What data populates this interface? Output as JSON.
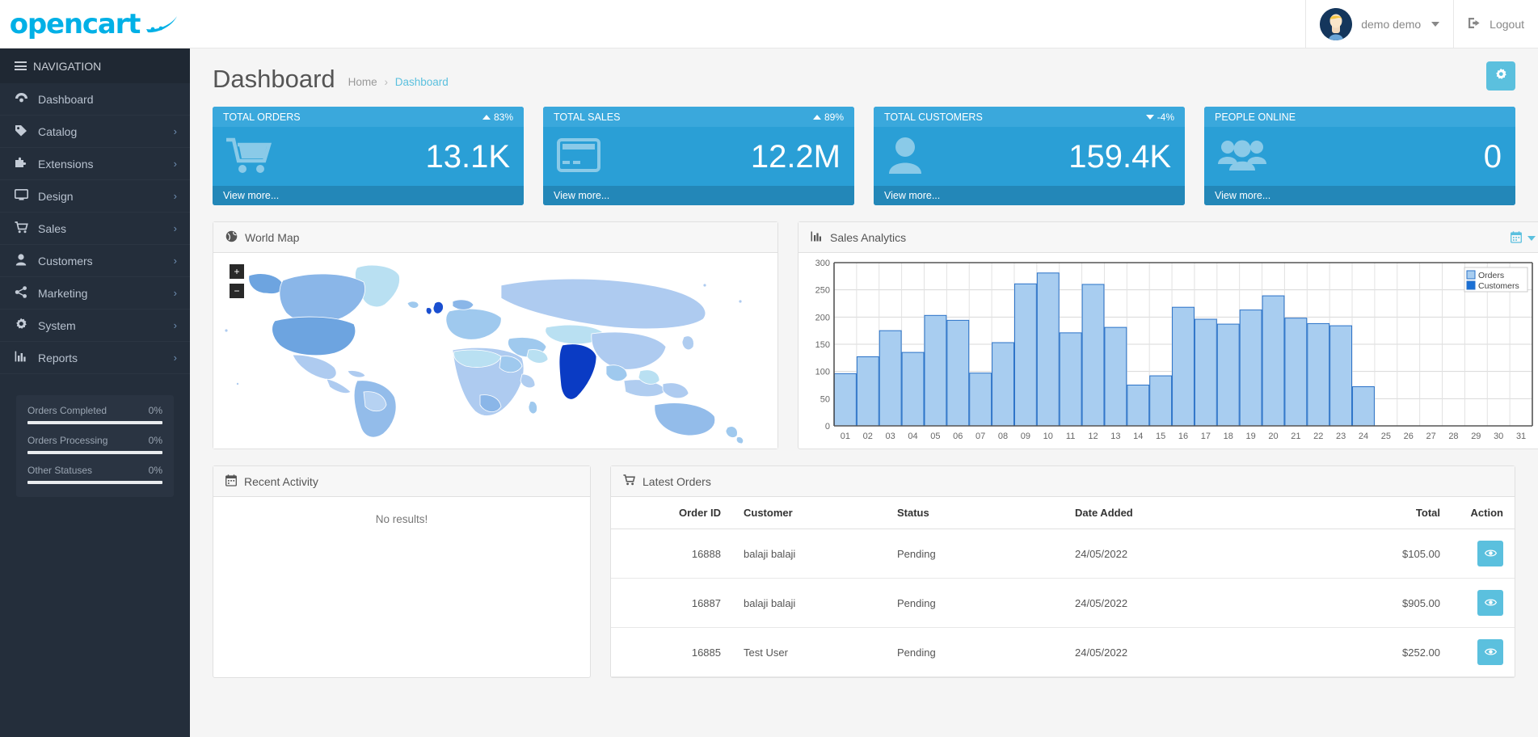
{
  "brand": {
    "logo_text": "opencart",
    "accent": "#00b0e6"
  },
  "header": {
    "user_name": "demo demo",
    "logout_label": "Logout",
    "user_caret_icon": "chevron-down-icon",
    "logout_icon": "sign-out-icon",
    "avatar_icon": "user-avatar"
  },
  "sidebar": {
    "nav_title": "NAVIGATION",
    "items": [
      {
        "label": "Dashboard",
        "icon": "dashboard-icon",
        "has_children": false
      },
      {
        "label": "Catalog",
        "icon": "tag-icon",
        "has_children": true
      },
      {
        "label": "Extensions",
        "icon": "puzzle-icon",
        "has_children": true
      },
      {
        "label": "Design",
        "icon": "desktop-icon",
        "has_children": true
      },
      {
        "label": "Sales",
        "icon": "cart-icon",
        "has_children": true
      },
      {
        "label": "Customers",
        "icon": "user-icon",
        "has_children": true
      },
      {
        "label": "Marketing",
        "icon": "share-icon",
        "has_children": true
      },
      {
        "label": "System",
        "icon": "gear-icon",
        "has_children": true
      },
      {
        "label": "Reports",
        "icon": "bar-chart-icon",
        "has_children": true
      }
    ],
    "progress": [
      {
        "label": "Orders Completed",
        "value": "0%",
        "percent": 0
      },
      {
        "label": "Orders Processing",
        "value": "0%",
        "percent": 0
      },
      {
        "label": "Other Statuses",
        "value": "0%",
        "percent": 0
      }
    ]
  },
  "page": {
    "title": "Dashboard",
    "breadcrumb_home": "Home",
    "breadcrumb_sep": "›",
    "breadcrumb_current": "Dashboard",
    "settings_icon": "gear-icon"
  },
  "tiles": [
    {
      "title": "TOTAL ORDERS",
      "percent": "83%",
      "direction": "up",
      "value": "13.1K",
      "footer": "View more...",
      "icon": "shopping-cart-icon"
    },
    {
      "title": "TOTAL SALES",
      "percent": "89%",
      "direction": "up",
      "value": "12.2M",
      "footer": "View more...",
      "icon": "credit-card-icon"
    },
    {
      "title": "TOTAL CUSTOMERS",
      "percent": "-4%",
      "direction": "down",
      "value": "159.4K",
      "footer": "View more...",
      "icon": "user-icon"
    },
    {
      "title": "PEOPLE ONLINE",
      "percent": "",
      "direction": "none",
      "value": "0",
      "footer": "View more...",
      "icon": "users-icon"
    }
  ],
  "map_panel": {
    "title": "World Map",
    "icon": "globe-icon",
    "zoom_in": "+",
    "zoom_out": "−"
  },
  "chart_panel": {
    "title": "Sales Analytics",
    "icon": "bar-chart-icon",
    "calendar_icon": "calendar-icon",
    "caret_icon": "chevron-down-icon"
  },
  "chart_data": {
    "type": "bar",
    "title": "Sales Analytics",
    "xlabel": "",
    "ylabel": "",
    "ylim": [
      0,
      300
    ],
    "yticks": [
      0,
      50,
      100,
      150,
      200,
      250,
      300
    ],
    "grid": true,
    "legend_position": "top-right",
    "categories": [
      "01",
      "02",
      "03",
      "04",
      "05",
      "06",
      "07",
      "08",
      "09",
      "10",
      "11",
      "12",
      "13",
      "14",
      "15",
      "16",
      "17",
      "18",
      "19",
      "20",
      "21",
      "22",
      "23",
      "24",
      "25",
      "26",
      "27",
      "28",
      "29",
      "30",
      "31"
    ],
    "series": [
      {
        "name": "Orders",
        "color": "#a8cdf0",
        "values": [
          96,
          127,
          175,
          135,
          203,
          194,
          97,
          153,
          261,
          281,
          171,
          260,
          181,
          75,
          92,
          218,
          196,
          187,
          213,
          239,
          198,
          188,
          184,
          72,
          0,
          0,
          0,
          0,
          0,
          0,
          0
        ]
      },
      {
        "name": "Customers",
        "color": "#1a6fd4",
        "values": [
          0,
          0,
          0,
          0,
          0,
          0,
          0,
          0,
          0,
          0,
          0,
          0,
          0,
          0,
          0,
          0,
          0,
          0,
          0,
          0,
          0,
          0,
          0,
          0,
          0,
          0,
          0,
          0,
          0,
          0,
          0
        ]
      }
    ]
  },
  "activity_panel": {
    "title": "Recent Activity",
    "icon": "calendar-icon",
    "empty_text": "No results!"
  },
  "orders_panel": {
    "title": "Latest Orders",
    "icon": "shopping-cart-icon",
    "columns": [
      "Order ID",
      "Customer",
      "Status",
      "Date Added",
      "Total",
      "Action"
    ],
    "rows": [
      {
        "order_id": "16888",
        "customer": "balaji balaji",
        "status": "Pending",
        "date_added": "24/05/2022",
        "total": "$105.00",
        "action_icon": "eye-icon"
      },
      {
        "order_id": "16887",
        "customer": "balaji balaji",
        "status": "Pending",
        "date_added": "24/05/2022",
        "total": "$905.00",
        "action_icon": "eye-icon"
      },
      {
        "order_id": "16885",
        "customer": "Test User",
        "status": "Pending",
        "date_added": "24/05/2022",
        "total": "$252.00",
        "action_icon": "eye-icon"
      }
    ]
  }
}
